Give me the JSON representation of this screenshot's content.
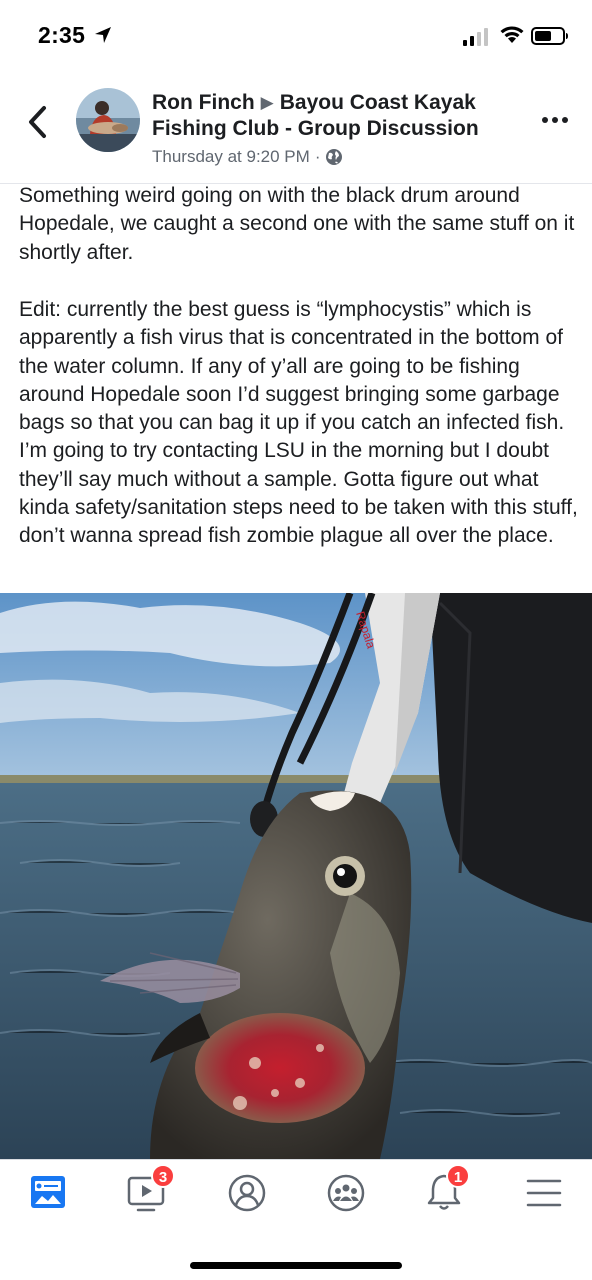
{
  "status_bar": {
    "time": "2:35",
    "icons": [
      "location-arrow-icon",
      "cellular-signal-icon",
      "wifi-icon",
      "battery-icon"
    ]
  },
  "header": {
    "author": "Ron Finch",
    "separator_icon": "triangle-right-icon",
    "group_line1": "Bayou Coast Kayak",
    "group_line2": "Fishing Club - Group Discussion",
    "timestamp": "Thursday at 9:20 PM",
    "dot": "·",
    "privacy_icon": "globe-icon",
    "back_icon": "chevron-left-icon",
    "more_icon": "more-dots-icon"
  },
  "post": {
    "paragraph1": "Something weird going on with the black drum around Hopedale, we caught a second one with the same stuff on it shortly after.",
    "paragraph2": "Edit: currently the best guess is “lymphocystis” which is apparently a fish virus that is concentrated in the bottom of the water column. If any of y’all are going to be fishing around Hopedale soon I’d suggest bringing some garbage bags so that you can bag it up if you catch an infected fish. I’m going to try contacting LSU in the morning but I doubt they’ll say much without a sample. Gotta figure out what kinda safety/sanitation steps need to be taken with this stuff, don’t wanna spread fish zombie plague all over the place.",
    "photo_lanyard_text": "Rapala"
  },
  "bottom_nav": {
    "items": [
      {
        "icon": "news-feed-icon",
        "badge": ""
      },
      {
        "icon": "watch-video-icon",
        "badge": "3"
      },
      {
        "icon": "profile-icon",
        "badge": ""
      },
      {
        "icon": "groups-icon",
        "badge": ""
      },
      {
        "icon": "notifications-bell-icon",
        "badge": "1"
      },
      {
        "icon": "menu-icon",
        "badge": ""
      }
    ]
  },
  "colors": {
    "facebook_blue": "#1877f2",
    "badge_red": "#fa3e3e",
    "secondary_text": "#606770"
  }
}
